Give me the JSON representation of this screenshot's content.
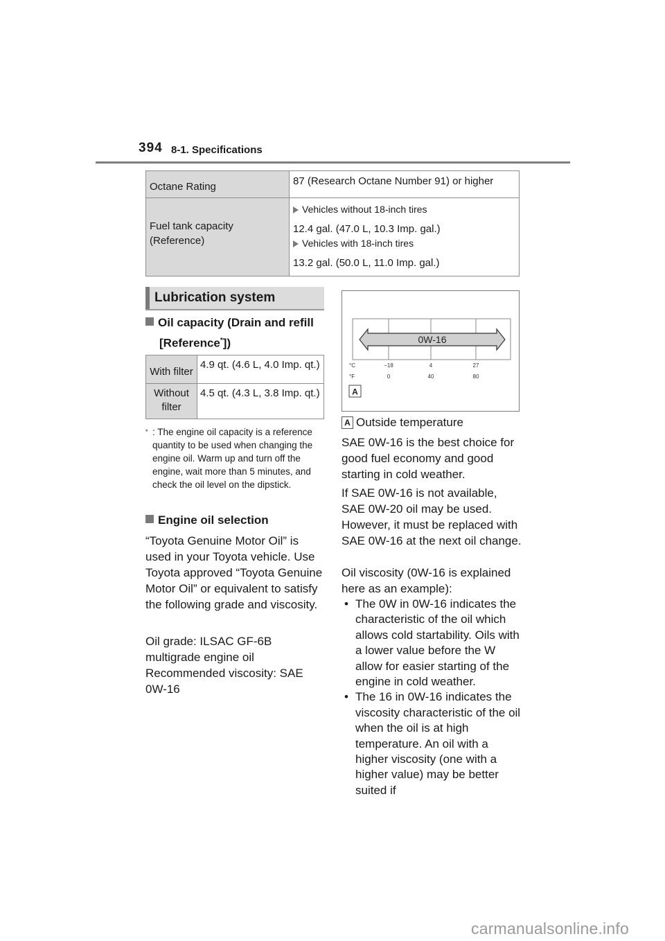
{
  "header": {
    "page_number": "394",
    "section": "8-1. Specifications"
  },
  "fuel_table": {
    "rows": [
      {
        "label": "Octane Rating",
        "value": "87 (Research Octane Number 91) or higher"
      },
      {
        "label_line1": "Fuel tank capacity",
        "label_line2": "(Reference)",
        "variants": [
          {
            "condition": "Vehicles without 18-inch tires",
            "amount": "12.4 gal. (47.0 L, 10.3 Imp. gal.)"
          },
          {
            "condition": "Vehicles with 18-inch tires",
            "amount": "13.2 gal. (50.0 L, 11.0 Imp. gal.)"
          }
        ]
      }
    ]
  },
  "lubrication": {
    "heading": "Lubrication system",
    "oil_capacity": {
      "heading_line1": "Oil capacity (Drain and refill",
      "heading_line2_pre": "[Reference",
      "heading_sup": "*",
      "heading_line2_post": "])",
      "rows": [
        {
          "label": "With filter",
          "value": "4.9 qt. (4.6 L, 4.0 Imp. qt.)"
        },
        {
          "label": "Without filter",
          "value": "4.5 qt. (4.3 L, 3.8 Imp. qt.)"
        }
      ],
      "footnote_mark": "*",
      "footnote": ": The engine oil capacity is a reference quantity to be used when changing the engine oil. Warm up and turn off the engine, wait more than 5 minutes, and check the oil level on the dipstick."
    },
    "engine_oil_selection": {
      "heading": "Engine oil selection",
      "paragraphs": [
        "“Toyota Genuine Motor Oil” is used in your Toyota vehicle. Use Toyota approved “Toyota Genuine Motor Oil” or equivalent to satisfy the following grade and viscosity.",
        "Oil grade: ILSAC GF-6B multigrade engine oil",
        "Recommended viscosity: SAE 0W-16"
      ]
    }
  },
  "diagram": {
    "arrow_label": "0W-16",
    "celsius_unit": "°C",
    "fahrenheit_unit": "°F",
    "celsius_ticks": [
      "−18",
      "4",
      "27"
    ],
    "fahrenheit_ticks": [
      "0",
      "40",
      "80"
    ],
    "callout": "A"
  },
  "right_column": {
    "legend_key": "A",
    "legend_text": "Outside temperature",
    "paragraphs": [
      "SAE 0W-16 is the best choice for good fuel economy and good starting in cold weather.",
      "If SAE 0W-16 is not available, SAE 0W-20 oil may be used. However, it must be replaced with SAE 0W-16 at the next oil change.",
      "Oil viscosity (0W-16 is explained here as an example):"
    ],
    "bullets": [
      "The 0W in 0W-16 indicates the characteristic of the oil which allows cold startability. Oils with a lower value before the W allow for easier starting of the engine in cold weather.",
      "The 16 in 0W-16 indicates the viscosity characteristic of the oil when the oil is at high temperature. An oil with a higher viscosity (one with a higher value) may be better suited if"
    ],
    "bullet_glyph": "•"
  },
  "watermark": "carmanualsonline.info"
}
